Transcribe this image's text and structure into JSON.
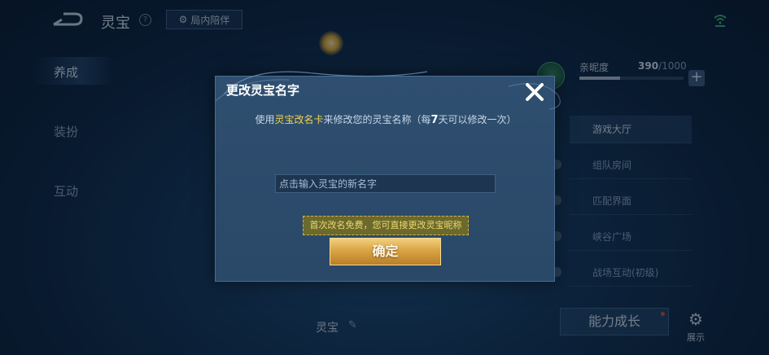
{
  "header": {
    "title": "灵宝",
    "help_glyph": "?",
    "companion_label": "局内陪伴"
  },
  "nav": {
    "items": [
      {
        "label": "养成",
        "active": true
      },
      {
        "label": "装扮",
        "active": false
      },
      {
        "label": "互动",
        "active": false
      }
    ]
  },
  "intimacy": {
    "label": "亲昵度",
    "current": "390",
    "max": "/1000",
    "progress": 0.39,
    "plus": "+"
  },
  "side_list": {
    "items": [
      {
        "label": "游戏大厅",
        "active": true
      },
      {
        "label": "组队房间",
        "active": false
      },
      {
        "label": "匹配界面",
        "active": false
      },
      {
        "label": "峡谷广场",
        "active": false
      },
      {
        "label": "战场互动(初级)",
        "active": false
      }
    ]
  },
  "pet": {
    "name": "灵宝"
  },
  "bottom": {
    "ability_label": "能力成长",
    "settings_label": "展示"
  },
  "dialog": {
    "title": "更改灵宝名字",
    "desc_prefix": "使用",
    "desc_card": "灵宝改名卡",
    "desc_mid": "来修改您的灵宝名称（每",
    "desc_days": "7",
    "desc_suffix": "天可以修改一次）",
    "input_placeholder": "点击输入灵宝的新名字",
    "input_value": "",
    "free_tip": "首次改名免费，您可直接更改灵宝昵称",
    "confirm_label": "确定"
  },
  "colors": {
    "highlight": "#f2d34a",
    "confirm_gold": "#d9a445",
    "dialog_bg": "#2f4f70"
  }
}
